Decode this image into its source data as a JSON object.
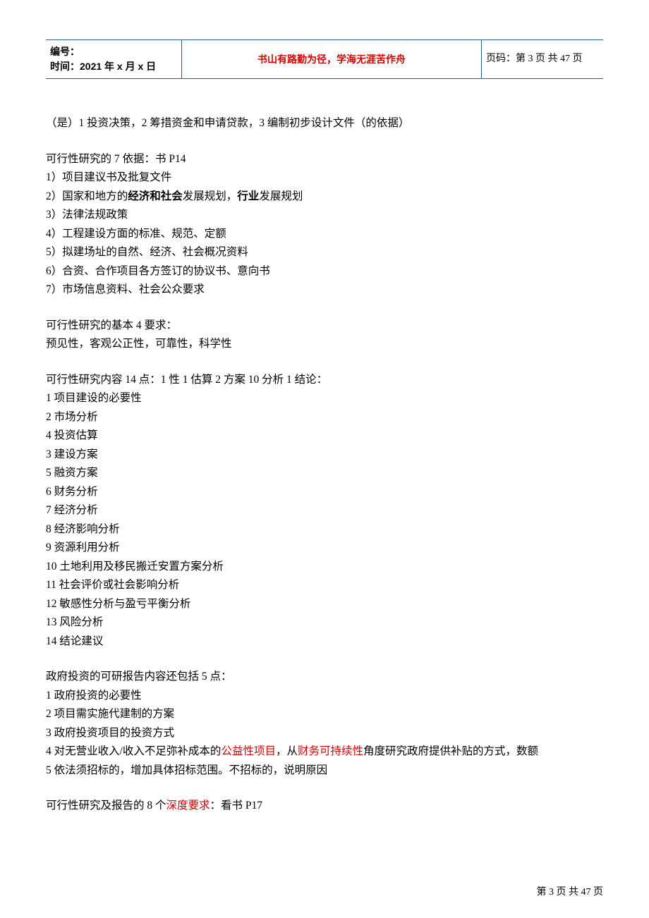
{
  "header": {
    "left_line1": "编号：",
    "left_line2": "时间：2021 年 x 月 x 日",
    "center": "书山有路勤为径，学海无涯苦作舟",
    "right": "页码：第 3 页 共 47 页"
  },
  "content": {
    "line_intro": "（是）1 投资决策，2 筹措资金和申请贷款，3 编制初步设计文件（的依据）",
    "sec1_title": "可行性研究的 7 依据：书 P14",
    "sec1_items": [
      "1）项目建议书及批复文件",
      "2）国家和地方的",
      "发展规划，",
      "发展规划",
      "3）法律法规政策",
      "4）工程建设方面的标准、规范、定额",
      "5）拟建场址的自然、经济、社会概况资料",
      "6）合资、合作项目各方签订的协议书、意向书",
      "7）市场信息资料、社会公众要求"
    ],
    "sec1_bold1": "经济和社会",
    "sec1_bold2": "行业",
    "sec2_title": "可行性研究的基本 4 要求：",
    "sec2_line": "预见性，客观公正性，可靠性，科学性",
    "sec3_title": "可行性研究内容 14 点：1 性 1 估算 2 方案 10 分析 1 结论：",
    "sec3_items": [
      "1 项目建设的必要性",
      "2 市场分析",
      "4 投资估算",
      "3 建设方案",
      "5 融资方案",
      "6 财务分析",
      "7 经济分析",
      "8 经济影响分析",
      "9 资源利用分析",
      "10 土地利用及移民搬迁安置方案分析",
      "11 社会评价或社会影响分析",
      "12 敏感性分析与盈亏平衡分析",
      "13 风险分析",
      "14 结论建议"
    ],
    "sec4_title": "政府投资的可研报告内容还包括 5 点：",
    "sec4_items": [
      "1 政府投资的必要性",
      "2 项目需实施代建制的方案",
      "3 政府投资项目的投资方式"
    ],
    "sec4_item4_a": "4 对无营业收入/收入不足弥补成本的",
    "sec4_item4_red1": "公益性项目",
    "sec4_item4_b": "，从",
    "sec4_item4_red2": "财务可持续性",
    "sec4_item4_c": "角度研究政府提供补贴的方式，数额",
    "sec4_item5": "5 依法须招标的，增加具体招标范围。不招标的，说明原因",
    "sec5_a": "可行性研究及报告的 8 个",
    "sec5_red": "深度要求",
    "sec5_b": "：看书 P17"
  },
  "footer": "第 3 页 共 47 页"
}
